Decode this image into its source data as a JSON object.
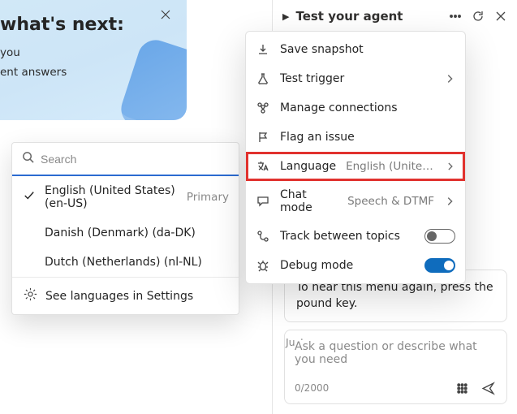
{
  "hero": {
    "title": "what's next:",
    "line1": "you",
    "line2": "ent answers"
  },
  "lang_popup": {
    "search_placeholder": "Search",
    "items": [
      {
        "label": "English (United States) (en-US)",
        "badge": "Primary",
        "selected": true
      },
      {
        "label": "Danish (Denmark) (da-DK)",
        "badge": "",
        "selected": false
      },
      {
        "label": "Dutch (Netherlands) (nl-NL)",
        "badge": "",
        "selected": false
      }
    ],
    "footer": "See languages in Settings"
  },
  "panel": {
    "title": "Test your agent"
  },
  "menu": {
    "save_snapshot": "Save snapshot",
    "test_trigger": "Test trigger",
    "manage_connections": "Manage connections",
    "flag_issue": "Flag an issue",
    "language_label": "Language",
    "language_value": "English (United …",
    "chat_mode_label": "Chat mode",
    "chat_mode_value": "Speech & DTMF",
    "track_topics": "Track between topics",
    "debug_mode": "Debug mode",
    "track_on": false,
    "debug_on": true
  },
  "chat": {
    "bubble": "To hear this menu again, press the pound key.",
    "timestamp": "Just now",
    "placeholder": "Ask a question or describe what you need",
    "counter": "0/2000"
  }
}
